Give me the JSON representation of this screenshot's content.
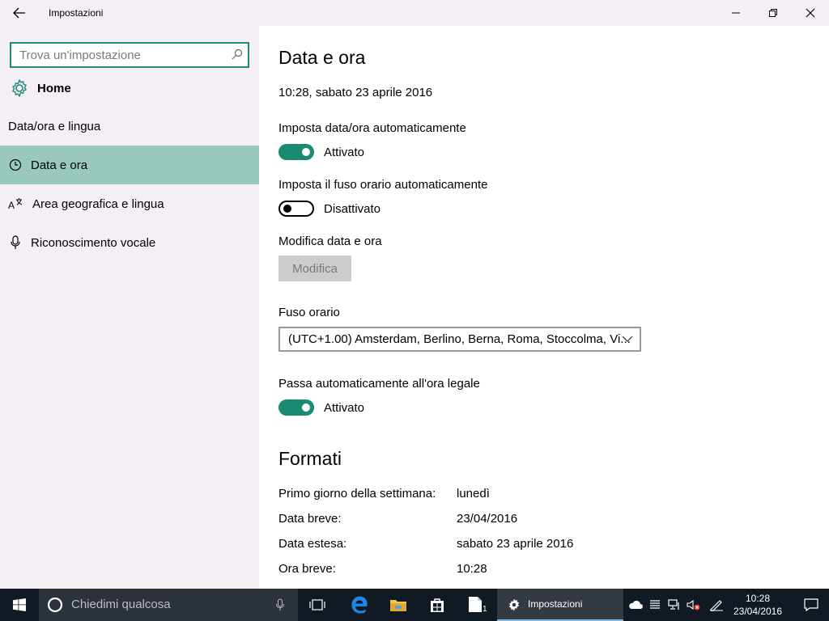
{
  "window": {
    "title": "Impostazioni"
  },
  "sidebar": {
    "search_placeholder": "Trova un'impostazione",
    "home_label": "Home",
    "group_label": "Data/ora e lingua",
    "items": [
      {
        "label": "Data e ora",
        "icon": "clock-icon",
        "active": true
      },
      {
        "label": "Area geografica e lingua",
        "icon": "language-icon",
        "active": false
      },
      {
        "label": "Riconoscimento vocale",
        "icon": "microphone-icon",
        "active": false
      }
    ]
  },
  "main": {
    "title": "Data e ora",
    "current_datetime": "10:28, sabato 23 aprile 2016",
    "auto_time": {
      "label": "Imposta data/ora automaticamente",
      "state": "Attivato",
      "on": true
    },
    "auto_timezone": {
      "label": "Imposta il fuso orario automaticamente",
      "state": "Disattivato",
      "on": false
    },
    "change_datetime": {
      "label": "Modifica data e ora",
      "button": "Modifica"
    },
    "timezone": {
      "label": "Fuso orario",
      "value": "(UTC+1.00) Amsterdam, Berlino, Berna, Roma, Stoccolma, Vi..."
    },
    "dst": {
      "label": "Passa automaticamente all'ora legale",
      "state": "Attivato",
      "on": true
    },
    "formats": {
      "title": "Formati",
      "rows": [
        {
          "label": "Primo giorno della settimana:",
          "value": "lunedì"
        },
        {
          "label": "Data breve:",
          "value": "23/04/2016"
        },
        {
          "label": "Data estesa:",
          "value": "sabato 23 aprile 2016"
        },
        {
          "label": "Ora breve:",
          "value": "10:28"
        }
      ]
    }
  },
  "taskbar": {
    "cortana_placeholder": "Chiedimi qualcosa",
    "active_app": "Impostazioni",
    "store_badge": "1",
    "time": "10:28",
    "date": "23/04/2016"
  },
  "colors": {
    "accent": "#1a8a73",
    "sidebar_bg": "#f3eff5",
    "active_item_bg": "#98c8be",
    "taskbar_bg": "#111a22"
  }
}
